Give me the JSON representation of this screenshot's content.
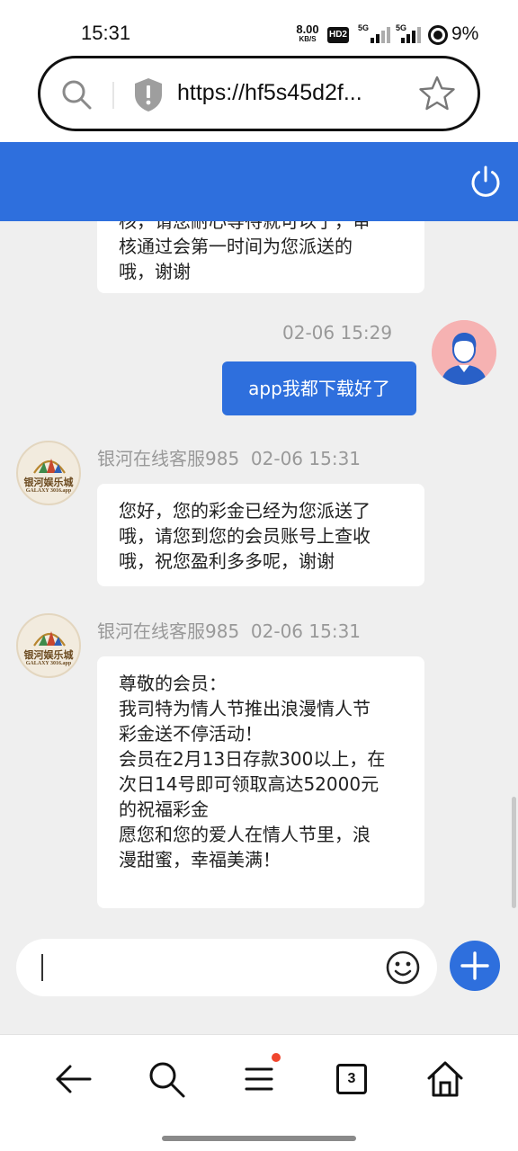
{
  "status_bar": {
    "time": "15:31",
    "net_speed_value": "8.00",
    "net_speed_unit": "KB/S",
    "hd_label": "HD2",
    "signal_1_label": "5G",
    "signal_2_label": "5G",
    "battery_percent": "9%"
  },
  "browser": {
    "url": "https://hf5s45d2f...",
    "search_icon": "search-icon",
    "security_icon": "shield-warning-icon",
    "bookmark_icon": "star-icon"
  },
  "header": {
    "power_icon": "power-icon",
    "accent_color": "#2e6fdd"
  },
  "messages": [
    {
      "side": "left",
      "lines": [
        "核，请您耐心等待就可以了，审",
        "核通过会第一时间为您派送的",
        "哦，谢谢"
      ]
    },
    {
      "side": "right",
      "timestamp": "02-06 15:29",
      "text": "app我都下载好了"
    },
    {
      "side": "left",
      "sender": "银河在线客服985",
      "timestamp": "02-06 15:31",
      "lines": [
        "您好，您的彩金已经为您派送了",
        "哦，请您到您的会员账号上查收",
        "哦，祝您盈利多多呢，谢谢"
      ]
    },
    {
      "side": "left",
      "sender": "银河在线客服985",
      "timestamp": "02-06 15:31",
      "lines": [
        "尊敬的会员：",
        "我司特为情人节推出浪漫情人节",
        "彩金送不停活动！",
        "会员在2月13日存款300以上，在",
        "次日14号即可领取高达52000元",
        "的祝福彩金",
        "愿您和您的爱人在情人节里，浪",
        "漫甜蜜，幸福美满！"
      ]
    }
  ],
  "avatar_logo": {
    "name_cn": "银河娱乐城",
    "name_en": "GALAXY 3016.app"
  },
  "composer": {
    "value": "",
    "emoji_icon": "smiley-icon",
    "add_icon": "plus-icon"
  },
  "bottom_nav": {
    "back_icon": "back-arrow-icon",
    "search_icon": "search-icon",
    "menu_icon": "menu-icon",
    "tab_count": "3",
    "home_icon": "home-icon"
  }
}
